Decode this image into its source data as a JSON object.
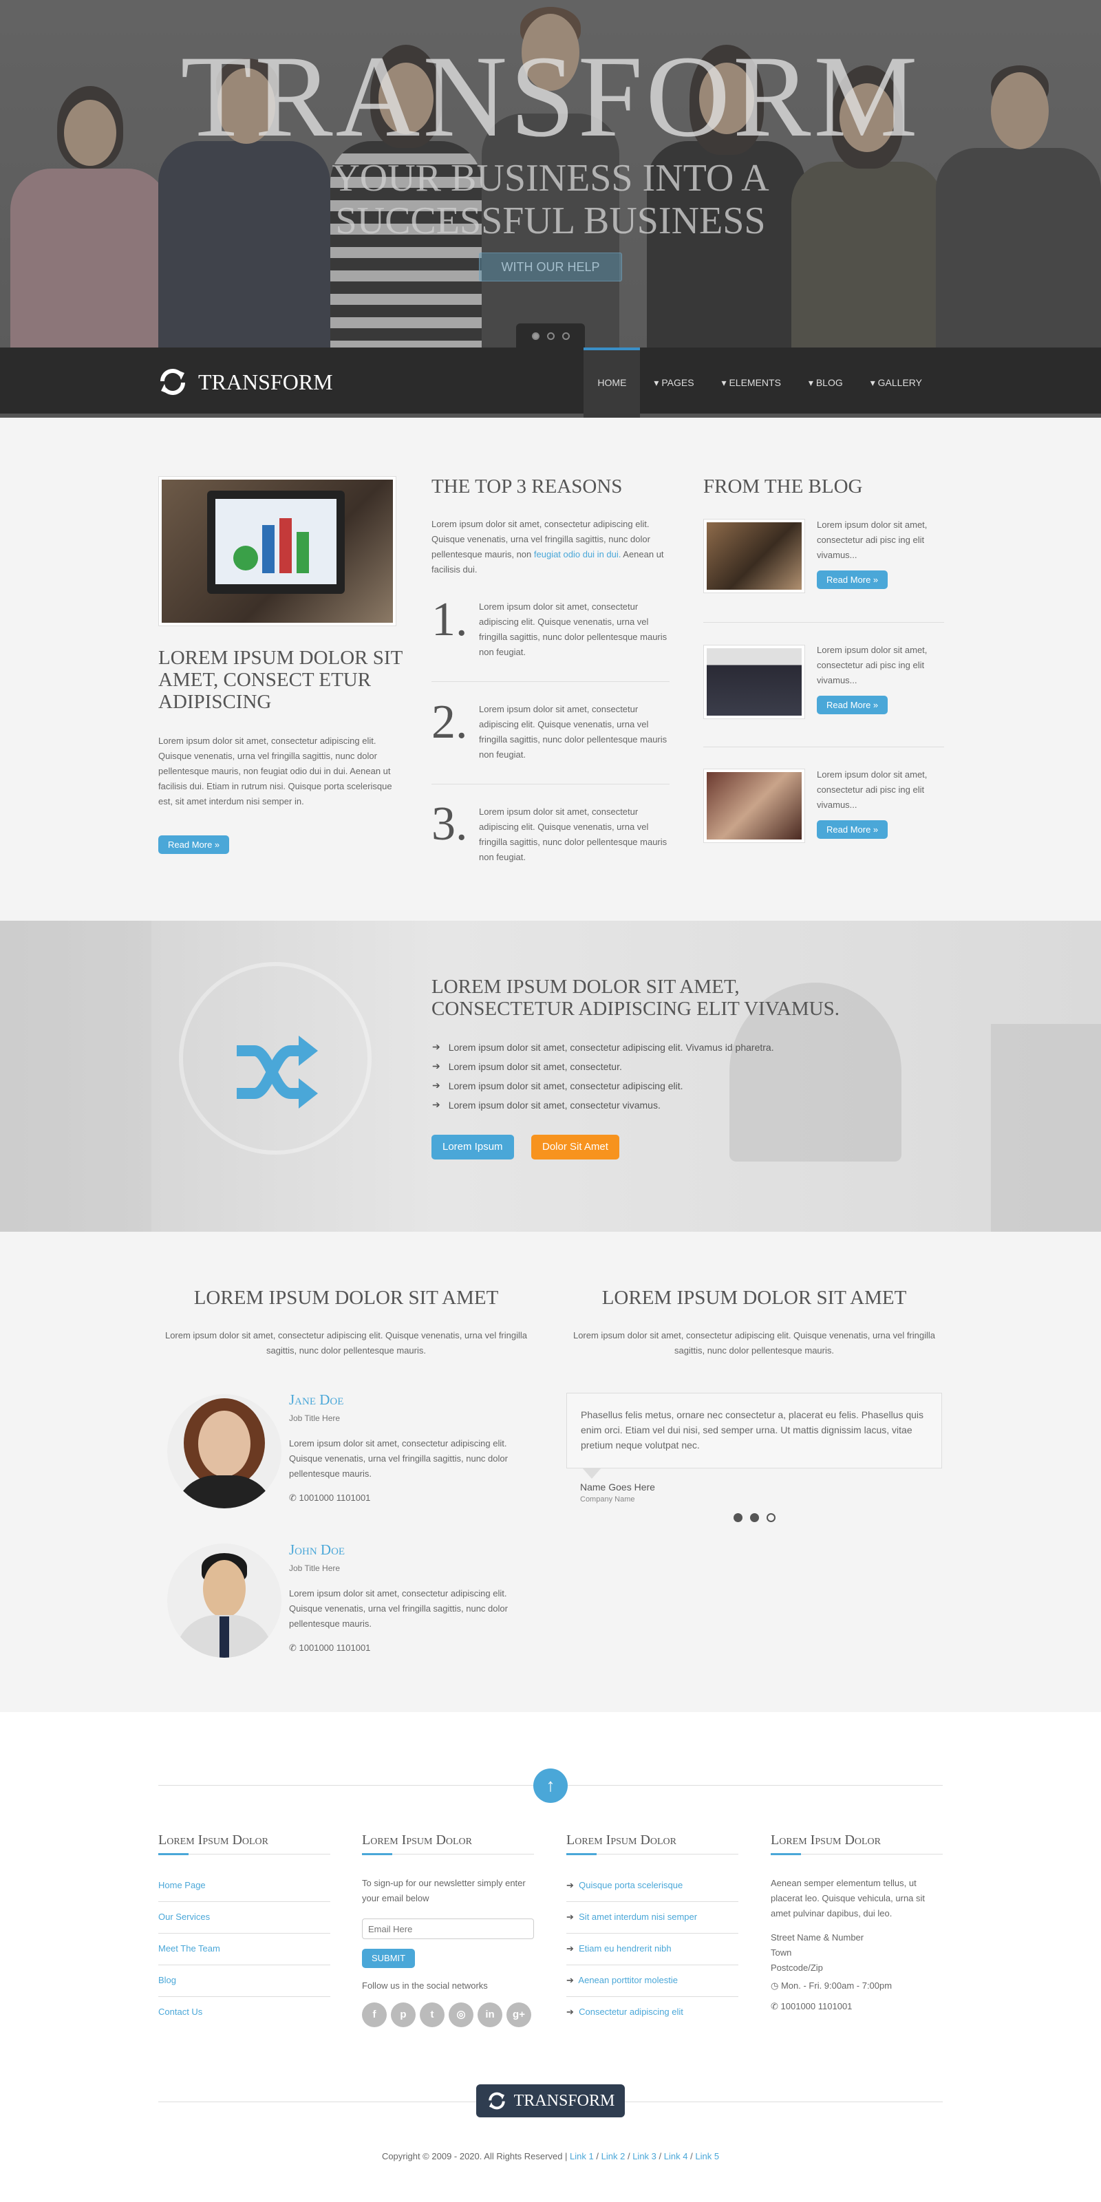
{
  "hero": {
    "title": "TRANSFORM",
    "subtitle_line1": "YOUR BUSINESS INTO A",
    "subtitle_line2": "SUCCESSFUL BUSINESS",
    "cta": "WITH OUR HELP"
  },
  "nav": {
    "logo_text": "TRANSFORM",
    "items": [
      {
        "label": "HOME"
      },
      {
        "label": "▾ PAGES"
      },
      {
        "label": "▾ ELEMENTS"
      },
      {
        "label": "▾ BLOG"
      },
      {
        "label": "▾ GALLERY"
      }
    ]
  },
  "col1": {
    "title": "LOREM IPSUM DOLOR SIT AMET, CONSECT ETUR ADIPISCING",
    "body": "Lorem ipsum dolor sit amet, consectetur adipiscing elit. Quisque venenatis, urna vel fringilla sagittis, nunc dolor pellentesque mauris, non feugiat odio dui in dui. Aenean ut facilisis dui. Etiam in rutrum nisi. Quisque porta scelerisque est, sit amet interdum nisi semper in.",
    "button": "Read More »"
  },
  "col2": {
    "title": "THE TOP 3 REASONS",
    "intro": "Lorem ipsum dolor sit amet, consectetur adipiscing elit. Quisque venenatis, urna vel fringilla sagittis, nunc dolor pellentesque mauris, non",
    "intro_link": "feugiat odio dui in dui.",
    "intro_end": " Aenean ut facilisis dui.",
    "reasons": [
      {
        "num": "1.",
        "text": "Lorem ipsum dolor sit amet, consectetur adipiscing elit. Quisque venenatis, urna vel fringilla sagittis, nunc dolor pellentesque mauris non feugiat."
      },
      {
        "num": "2.",
        "text": "Lorem ipsum dolor sit amet, consectetur adipiscing elit. Quisque venenatis, urna vel fringilla sagittis, nunc dolor pellentesque mauris non feugiat."
      },
      {
        "num": "3.",
        "text": "Lorem ipsum dolor sit amet, consectetur adipiscing elit. Quisque venenatis, urna vel fringilla sagittis, nunc dolor pellentesque mauris non feugiat."
      }
    ]
  },
  "col3": {
    "title": "FROM THE BLOG",
    "posts": [
      {
        "text": "Lorem ipsum dolor sit amet, consectetur adi pisc ing elit vivamus...",
        "button": "Read More »"
      },
      {
        "text": "Lorem ipsum dolor sit amet, consectetur adi pisc ing elit vivamus...",
        "button": "Read More »"
      },
      {
        "text": "Lorem ipsum dolor sit amet, consectetur adi pisc ing elit vivamus...",
        "button": "Read More »"
      }
    ]
  },
  "banner": {
    "title": "LOREM IPSUM DOLOR SIT AMET, CONSECTETUR ADIPISCING ELIT VIVAMUS.",
    "items": [
      "Lorem ipsum dolor sit amet, consectetur adipiscing elit. Vivamus id pharetra.",
      "Lorem ipsum dolor sit amet, consectetur.",
      "Lorem ipsum dolor sit amet, consectetur adipiscing elit.",
      "Lorem ipsum dolor sit amet, consectetur vivamus."
    ],
    "button_primary": "Lorem Ipsum",
    "button_secondary": "Dolor Sit Amet",
    "accent": "#4aa7d8",
    "orange": "#f7931e"
  },
  "team": {
    "title": "LOREM IPSUM DOLOR SIT AMET",
    "intro": "Lorem ipsum dolor sit amet, consectetur adipiscing elit. Quisque venenatis, urna vel fringilla sagittis, nunc dolor pellentesque mauris.",
    "members": [
      {
        "name": "Jane Doe",
        "job": "Job Title Here",
        "bio": "Lorem ipsum dolor sit amet, consectetur adipiscing elit. Quisque venenatis, urna vel fringilla sagittis, nunc dolor pellentesque mauris.",
        "phone": "1001000 1101001"
      },
      {
        "name": "John Doe",
        "job": "Job Title Here",
        "bio": "Lorem ipsum dolor sit amet, consectetur adipiscing elit. Quisque venenatis, urna vel fringilla sagittis, nunc dolor pellentesque mauris.",
        "phone": "1001000 1101001"
      }
    ]
  },
  "testimonials": {
    "title": "LOREM IPSUM DOLOR SIT AMET",
    "intro": "Lorem ipsum dolor sit amet, consectetur adipiscing elit. Quisque venenatis, urna vel fringilla sagittis, nunc dolor pellentesque mauris.",
    "quote": "Phasellus felis metus, ornare nec consectetur a, placerat eu felis. Phasellus quis enim orci. Etiam vel dui nisi, sed semper urna. Ut mattis dignissim lacus, vitae pretium neque volutpat nec.",
    "name": "Name Goes Here",
    "company": "Company Name"
  },
  "footer": {
    "col1": {
      "title": "Lorem Ipsum Dolor",
      "links": [
        "Home Page",
        "Our Services",
        "Meet The Team",
        "Blog",
        "Contact Us"
      ]
    },
    "col2": {
      "title": "Lorem Ipsum Dolor",
      "text": "To sign-up for our newsletter simply enter your email below",
      "placeholder": "Email Here",
      "button": "SUBMIT",
      "social_label": "Follow us in the social networks"
    },
    "col3": {
      "title": "Lorem Ipsum Dolor",
      "links": [
        "Quisque porta scelerisque",
        "Sit amet interdum nisi semper",
        "Etiam eu hendrerit nibh",
        "Aenean porttitor molestie",
        "Consectetur adipiscing elit"
      ]
    },
    "col4": {
      "title": "Lorem Ipsum Dolor",
      "text": "Aenean semper elementum tellus, ut placerat leo. Quisque vehicula, urna sit amet pulvinar dapibus, dui leo.",
      "street": "Street Name & Number",
      "town": "Town",
      "postcode": "Postcode/Zip",
      "hours": "Mon. - Fri. 9:00am - 7:00pm",
      "phone": "1001000 1101001"
    },
    "logo_text": "TRANSFORM",
    "copyright": "Copyright © 2009 - 2020. All Rights Reserved |",
    "links": [
      "Link 1",
      "Link 2",
      "Link 3",
      "Link 4",
      "Link 5"
    ],
    "separator": "/"
  }
}
